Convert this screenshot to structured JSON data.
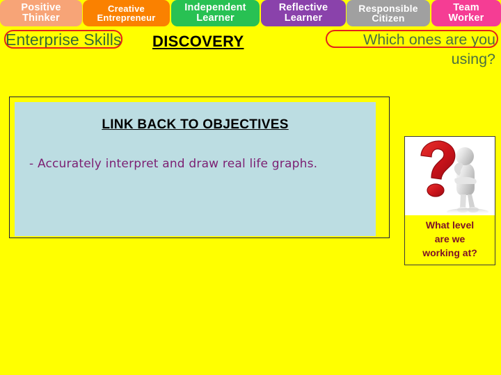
{
  "theme": {
    "background": "#ffff00",
    "panel_fill": "#bcdde2",
    "outline_red": "#e2231a",
    "heading_green": "#386b33",
    "objective_purple": "#7b1f72",
    "caption_maroon": "#7d1027"
  },
  "skills_band": {
    "tabs": [
      {
        "line1": "Positive",
        "line2": "Thinker",
        "color": "#f7a477"
      },
      {
        "line1": "Creative",
        "line2": "Entrepreneur",
        "color": "#fa8100"
      },
      {
        "line1": "Independent",
        "line2": "Learner",
        "color": "#28c153"
      },
      {
        "line1": "Reflective",
        "line2": "Learner",
        "color": "#8a42ab"
      },
      {
        "line1": "Responsible",
        "line2": "Citizen",
        "color": "#a0a0a0"
      },
      {
        "line1": "Team",
        "line2": "Worker",
        "color": "#f53d94"
      }
    ]
  },
  "header": {
    "enterprise_skills": "Enterprise Skills",
    "discovery": "DISCOVERY",
    "question_line1": "Which ones are you",
    "question_line2": "using?"
  },
  "objectives": {
    "title": "LINK BACK TO OBJECTIVES",
    "body": "- Accurately interpret and draw real life graphs."
  },
  "question_panel": {
    "image_alt": "question-mark-with-thinking-figure",
    "caption_line1": "What level",
    "caption_line2": "are we",
    "caption_line3": "working at?"
  }
}
